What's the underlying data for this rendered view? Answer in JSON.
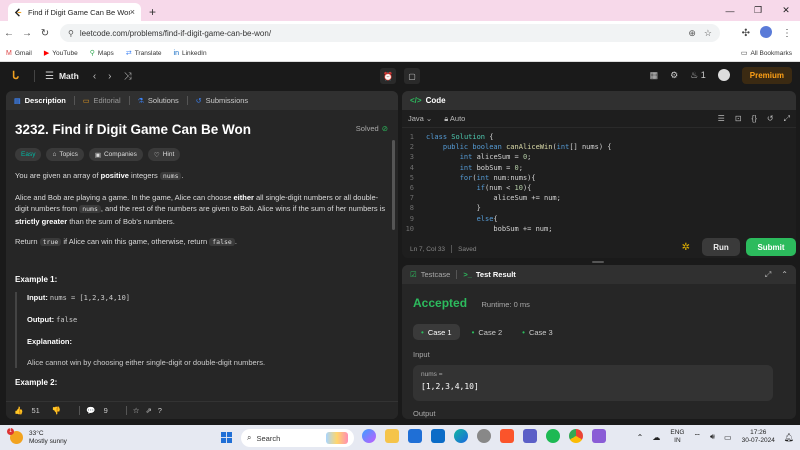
{
  "browser": {
    "tab_title": "Find if Digit Game Can Be Won",
    "url": "leetcode.com/problems/find-if-digit-game-can-be-won/",
    "bookmarks": [
      "Gmail",
      "YouTube",
      "Maps",
      "Translate",
      "LinkedIn"
    ],
    "all_bookmarks": "All Bookmarks"
  },
  "lcnav": {
    "list_title": "Math",
    "streak": "1",
    "premium": "Premium"
  },
  "left": {
    "tabs": [
      "Description",
      "Editorial",
      "Solutions",
      "Submissions"
    ],
    "title": "3232. Find if Digit Game Can Be Won",
    "solved": "Solved",
    "chips": [
      "Easy",
      "Topics",
      "Companies",
      "Hint"
    ],
    "desc": {
      "p1_a": "You are given an array of ",
      "p1_b": "positive",
      "p1_c": " integers ",
      "p1_code": "nums",
      "p1_d": ".",
      "p2_a": "Alice and Bob are playing a game. In the game, Alice can choose ",
      "p2_b": "either",
      "p2_c": " all single-digit numbers or all double-digit numbers from ",
      "p2_code": "nums",
      "p2_d": ", and the rest of the numbers are given to Bob. Alice wins if the sum of her numbers is ",
      "p2_e": "strictly greater",
      "p2_f": " than the sum of Bob's numbers.",
      "p3_a": "Return ",
      "p3_code1": "true",
      "p3_b": " if Alice can win this game, otherwise, return ",
      "p3_code2": "false",
      "p3_c": "."
    },
    "example1": {
      "heading": "Example 1:",
      "input_label": "Input:",
      "input_value": "nums = [1,2,3,4,10]",
      "output_label": "Output:",
      "output_value": "false",
      "explanation_label": "Explanation:",
      "explanation": "Alice cannot win by choosing either single-digit or double-digit numbers."
    },
    "example2_heading": "Example 2:",
    "footer": {
      "likes": "51",
      "comments": "9"
    }
  },
  "code": {
    "title": "Code",
    "language": "Java",
    "mode": "Auto",
    "lines": [
      {
        "n": "1",
        "text": "class Solution {"
      },
      {
        "n": "2",
        "text": "    public boolean canAliceWin(int[] nums) {"
      },
      {
        "n": "3",
        "text": "        int aliceSum = 0;"
      },
      {
        "n": "4",
        "text": "        int bobSum = 0;"
      },
      {
        "n": "5",
        "text": "        for(int num:nums){"
      },
      {
        "n": "6",
        "text": "            if(num < 10){"
      },
      {
        "n": "7",
        "text": "                aliceSum += num;"
      },
      {
        "n": "8",
        "text": "            }"
      },
      {
        "n": "9",
        "text": "            else{"
      },
      {
        "n": "10",
        "text": "                bobSum += num;"
      }
    ],
    "status_pos": "Ln 7, Col 33",
    "status_saved": "Saved",
    "run": "Run",
    "submit": "Submit"
  },
  "result": {
    "tab_testcase": "Testcase",
    "tab_result": "Test Result",
    "status": "Accepted",
    "runtime": "Runtime: 0 ms",
    "cases": [
      "Case 1",
      "Case 2",
      "Case 3"
    ],
    "input_label": "Input",
    "var_name": "nums =",
    "var_value": "[1,2,3,4,10]",
    "output_label": "Output"
  },
  "taskbar": {
    "temp": "33°C",
    "weather": "Mostly sunny",
    "badge": "1",
    "search": "Search",
    "lang1": "ENG",
    "lang2": "IN",
    "time": "17:26",
    "date": "30-07-2024"
  },
  "colors": {
    "accent_green": "#2cbb5d",
    "easy": "#00b8a3",
    "premium": "#ffa116"
  }
}
